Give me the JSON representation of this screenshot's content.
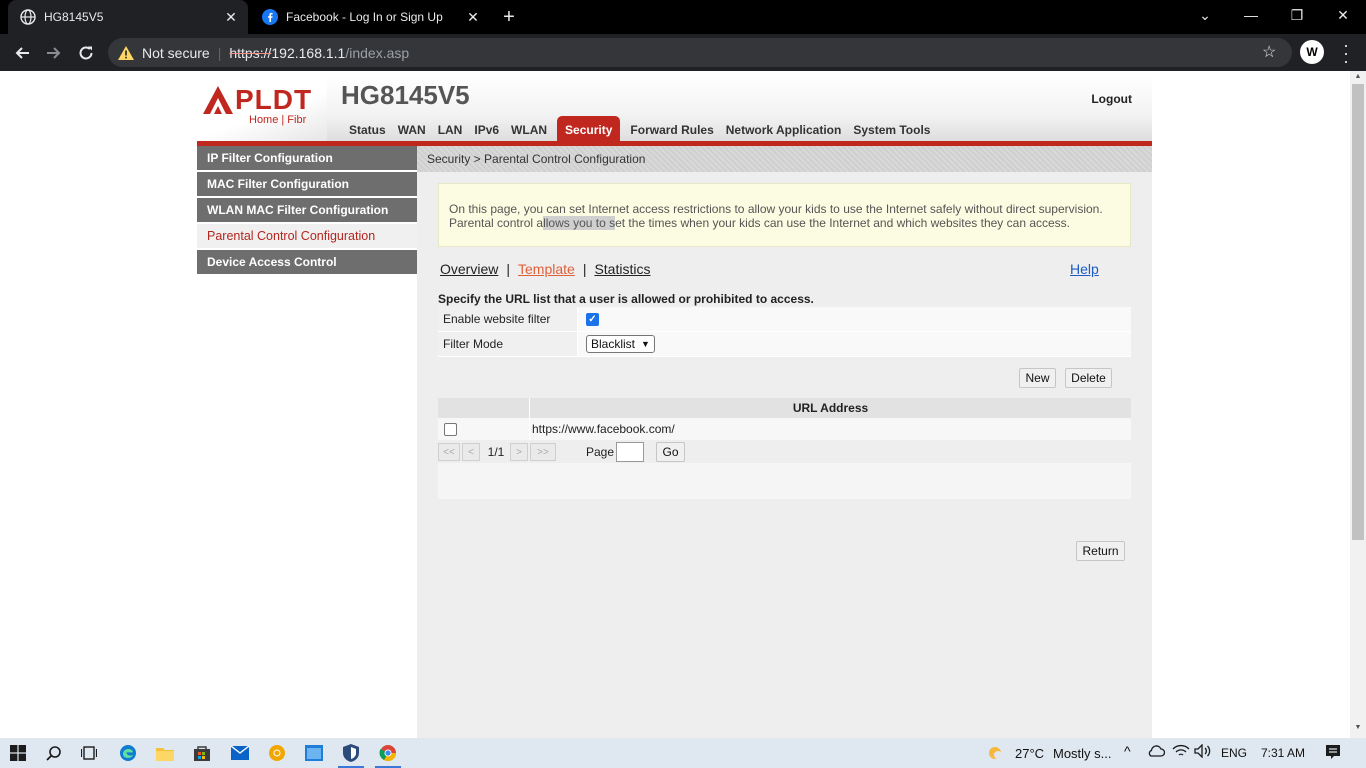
{
  "browser": {
    "tabs": [
      {
        "title": "HG8145V5",
        "active": true
      },
      {
        "title": "Facebook - Log In or Sign Up",
        "active": false
      }
    ],
    "new_tab_symbol": "+",
    "close_symbol": "✕",
    "address": {
      "security_label": "Not secure",
      "scheme": "https://",
      "host": "192.168.1.1",
      "path": "/index.asp"
    },
    "window_controls": {
      "minimize": "—",
      "restore": "❐",
      "close": "✕"
    },
    "profile_initial": "W"
  },
  "router": {
    "brand": "PLDT",
    "brand_sub": "Home | Fibr",
    "model": "HG8145V5",
    "logout": "Logout",
    "nav": [
      {
        "label": "Status",
        "active": false
      },
      {
        "label": "WAN",
        "active": false
      },
      {
        "label": "LAN",
        "active": false
      },
      {
        "label": "IPv6",
        "active": false
      },
      {
        "label": "WLAN",
        "active": false
      },
      {
        "label": "Security",
        "active": true
      },
      {
        "label": "Forward Rules",
        "active": false
      },
      {
        "label": "Network Application",
        "active": false
      },
      {
        "label": "System Tools",
        "active": false
      }
    ],
    "accent_color": "#c0271f"
  },
  "sidebar": {
    "items": [
      {
        "label": "IP Filter Configuration",
        "current": false
      },
      {
        "label": "MAC Filter Configuration",
        "current": false
      },
      {
        "label": "WLAN MAC Filter Configuration",
        "current": false
      },
      {
        "label": "Parental Control Configuration",
        "current": true
      },
      {
        "label": "Device Access Control",
        "current": false
      }
    ]
  },
  "content": {
    "breadcrumb": "Security > Parental Control Configuration",
    "info_line1": "On this page, you can set Internet access restrictions to allow your kids to use the Internet safely without direct supervision.",
    "info_line2_pre": "Parental control a",
    "info_line2_hl": "llows you to s",
    "info_line2_post": "et the times when your kids can use the Internet and which websites they can access.",
    "subtabs": {
      "overview": "Overview",
      "template": "Template",
      "statistics": "Statistics",
      "separator": "|",
      "help": "Help"
    },
    "spec_text": "Specify the URL list that a user is allowed or prohibited to access.",
    "form": {
      "enable_label": "Enable website filter",
      "enable_checked": true,
      "mode_label": "Filter Mode",
      "mode_value": "Blacklist"
    },
    "buttons": {
      "new": "New",
      "delete": "Delete",
      "go": "Go",
      "return": "Return"
    },
    "table": {
      "header": "URL Address",
      "rows": [
        {
          "url": "https://www.facebook.com/",
          "checked": false
        }
      ]
    },
    "pager": {
      "first": "<<",
      "prev": "<",
      "page_of": "1/1",
      "next": ">",
      "last": ">>",
      "page_label": "Page",
      "page_input": ""
    }
  },
  "taskbar": {
    "weather_temp": "27°C",
    "weather_desc": "Mostly s...",
    "language": "ENG",
    "time": "7:31 AM"
  }
}
